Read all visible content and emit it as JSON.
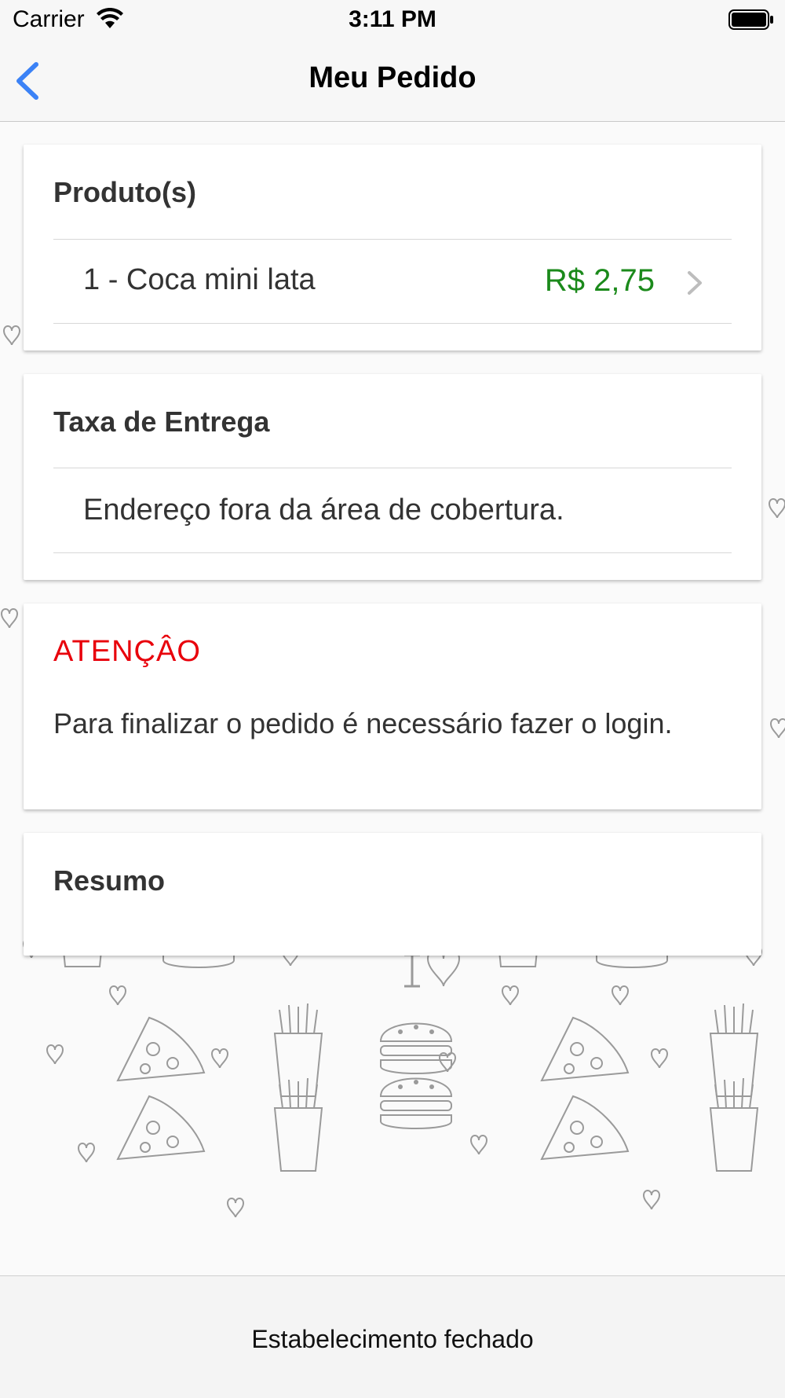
{
  "status_bar": {
    "carrier": "Carrier",
    "time": "3:11 PM",
    "icons": [
      "wifi-icon",
      "battery-icon"
    ]
  },
  "nav": {
    "title": "Meu Pedido",
    "back_icon": "chevron-left-icon"
  },
  "products": {
    "header": "Produto(s)",
    "items": [
      {
        "label": "1 - Coca mini lata",
        "price": "R$ 2,75"
      }
    ]
  },
  "delivery": {
    "header": "Taxa de Entrega",
    "message": "Endereço fora da área de cobertura."
  },
  "attention": {
    "title": "ATENÇÂO",
    "message": "Para finalizar o pedido é necessário fazer o login."
  },
  "summary": {
    "header": "Resumo"
  },
  "footer": {
    "status": "Estabelecimento fechado"
  },
  "colors": {
    "price": "#1b8a1b",
    "attention": "#e8000b",
    "back_arrow": "#3b82f6"
  }
}
